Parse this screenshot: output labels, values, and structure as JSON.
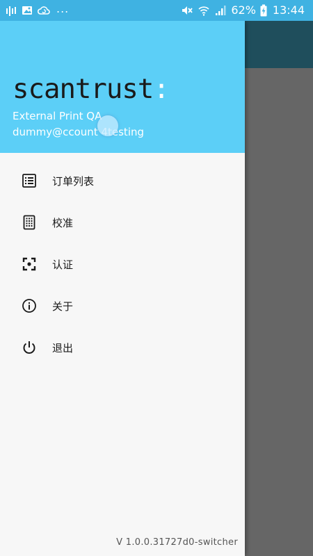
{
  "status_bar": {
    "battery": "62%",
    "time": "13:44",
    "overflow": "...",
    "left_icons": [
      "activity-icon",
      "image-icon",
      "cloud-sync-icon"
    ],
    "right_icons": [
      "mute-icon",
      "wifi-icon",
      "signal-icon",
      "battery-charging-icon"
    ]
  },
  "drawer": {
    "brand": {
      "name": "scantrust",
      "mark": ":"
    },
    "profile": {
      "name": "External Print QA",
      "email": "dummy@ccount 4testing"
    },
    "menu": [
      {
        "label": "订单列表",
        "icon": "order-list-icon"
      },
      {
        "label": "校准",
        "icon": "calibrate-icon"
      },
      {
        "label": "认证",
        "icon": "scan-verify-icon"
      },
      {
        "label": "关于",
        "icon": "info-icon"
      },
      {
        "label": "退出",
        "icon": "power-icon"
      }
    ],
    "version": "V 1.0.0.31727d0-switcher"
  },
  "colors": {
    "status_bar": "#3fb2e2",
    "drawer_header": "#5ccff7",
    "drawer_body": "#f7f7f7",
    "scrim": "#666666",
    "background_toolbar": "#1f4e5c"
  }
}
